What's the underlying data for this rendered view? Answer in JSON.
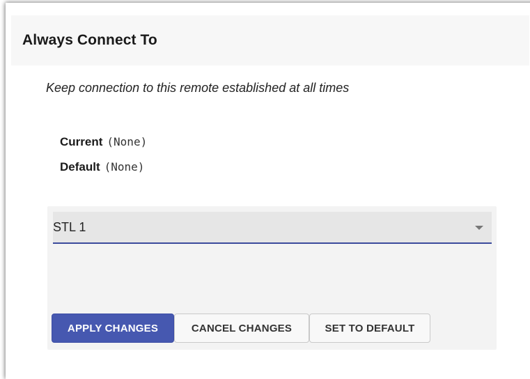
{
  "section": {
    "title": "Always Connect To",
    "description": "Keep connection to this remote established at all times"
  },
  "status": {
    "current_label": "Current",
    "current_value": "(None)",
    "default_label": "Default",
    "default_value": "(None)"
  },
  "remote_select": {
    "selected": "STL 1"
  },
  "buttons": {
    "apply": "APPLY CHANGES",
    "cancel": "CANCEL CHANGES",
    "default": "SET TO DEFAULT"
  },
  "colors": {
    "primary": "#4658b0",
    "underline": "#3a4a9c"
  }
}
